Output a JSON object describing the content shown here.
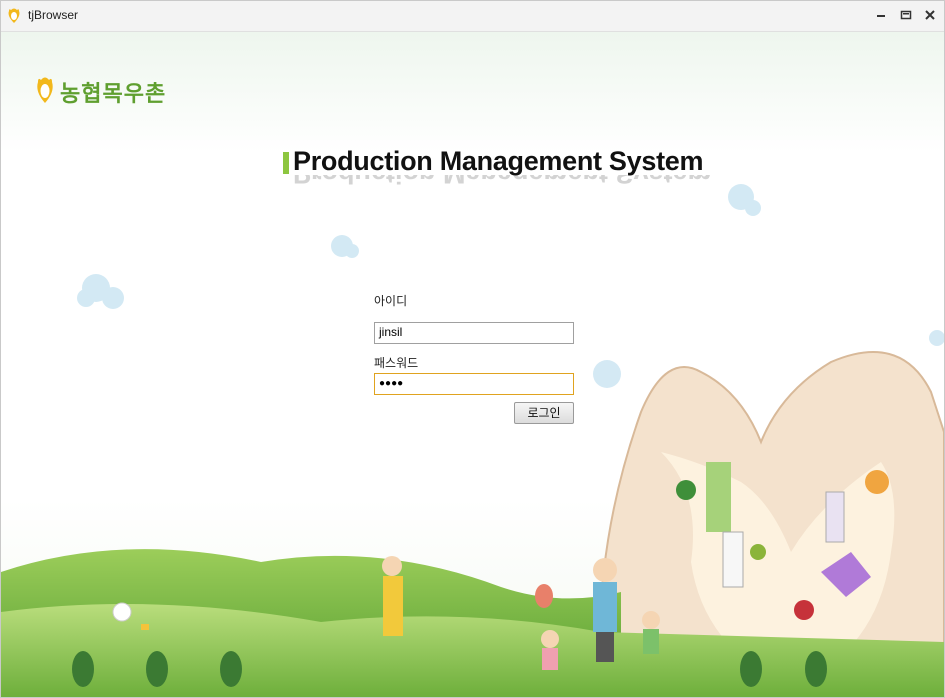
{
  "window": {
    "title": "tjBrowser",
    "icons": {
      "app": "flower-app-icon",
      "minimize": "minimize-icon",
      "restore": "restore-icon",
      "close": "close-icon"
    }
  },
  "logo": {
    "text": "농협목우촌"
  },
  "header": {
    "title": "Production Management System"
  },
  "login": {
    "id_label": "아이디",
    "id_value": "jinsil",
    "password_label": "패스워드",
    "password_value": "●●●●",
    "submit_label": "로그인"
  },
  "colors": {
    "accent_green": "#8dc63f",
    "brand_green": "#5f9f2f",
    "focus_border": "#e0a31f"
  }
}
